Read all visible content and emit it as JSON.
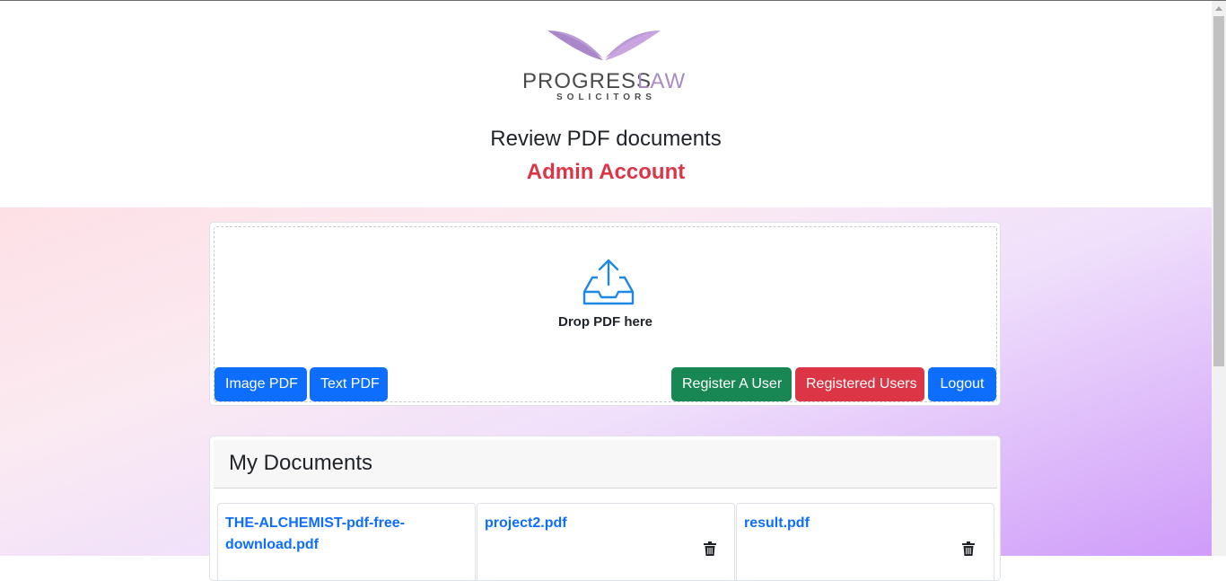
{
  "brand": {
    "name_part1": "PROGRESS",
    "name_part2": "LAW",
    "tagline": "SOLICITORS",
    "colors": {
      "dark": "#4a4a4a",
      "purple": "#a98bc6",
      "purple_light": "#c9a5e0"
    }
  },
  "header": {
    "title": "Review PDF documents",
    "account": "Admin Account"
  },
  "upload": {
    "icon": "upload-tray-icon",
    "drop_text": "Drop PDF here",
    "buttons": {
      "image_pdf": "Image PDF",
      "text_pdf": "Text PDF",
      "register_user": "Register A User",
      "registered_users": "Registered Users",
      "logout": "Logout"
    }
  },
  "documents": {
    "title": "My Documents",
    "items": [
      {
        "line1": "THE-ALCHEMIST-pdf-free-",
        "line2": "download.pdf"
      },
      {
        "line1": "project2.pdf",
        "line2": ""
      },
      {
        "line1": "result.pdf",
        "line2": ""
      }
    ]
  },
  "colors": {
    "primary": "#0d6efd",
    "success": "#198754",
    "danger": "#dc3545"
  }
}
